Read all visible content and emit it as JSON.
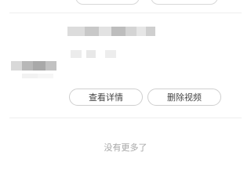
{
  "list_item": {
    "actions": {
      "view_details_label": "查看详情",
      "delete_video_label": "删除视频"
    }
  },
  "footer": {
    "no_more_text": "没有更多了"
  },
  "colors": {
    "background": "#ffffff",
    "button_border": "#cfcfcf",
    "divider": "#eeeeee",
    "muted_text": "#a6a6a6"
  }
}
